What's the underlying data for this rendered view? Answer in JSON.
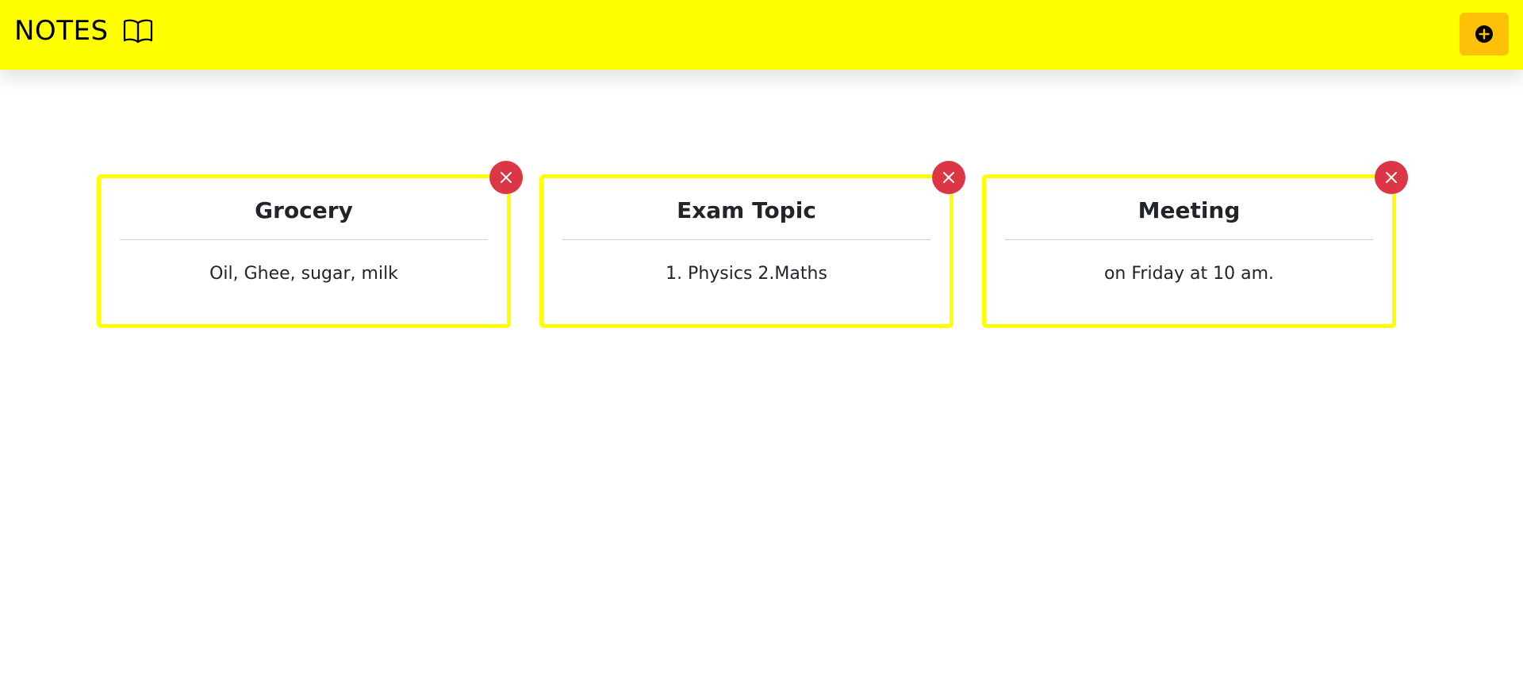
{
  "header": {
    "title": "NOTES",
    "brand_icon": "book-icon",
    "add_button_icon": "plus-circle-icon",
    "background_color": "#ffff00",
    "add_button_color": "#ffc107"
  },
  "notes": [
    {
      "title": "Grocery",
      "body": "Oil, Ghee, sugar, milk",
      "delete_icon": "close-icon"
    },
    {
      "title": "Exam Topic",
      "body": "1. Physics 2.Maths",
      "delete_icon": "close-icon"
    },
    {
      "title": "Meeting",
      "body": "on Friday at 10 am.",
      "delete_icon": "close-icon"
    }
  ],
  "colors": {
    "card_border": "#ffff00",
    "delete_button": "#dc3545"
  }
}
